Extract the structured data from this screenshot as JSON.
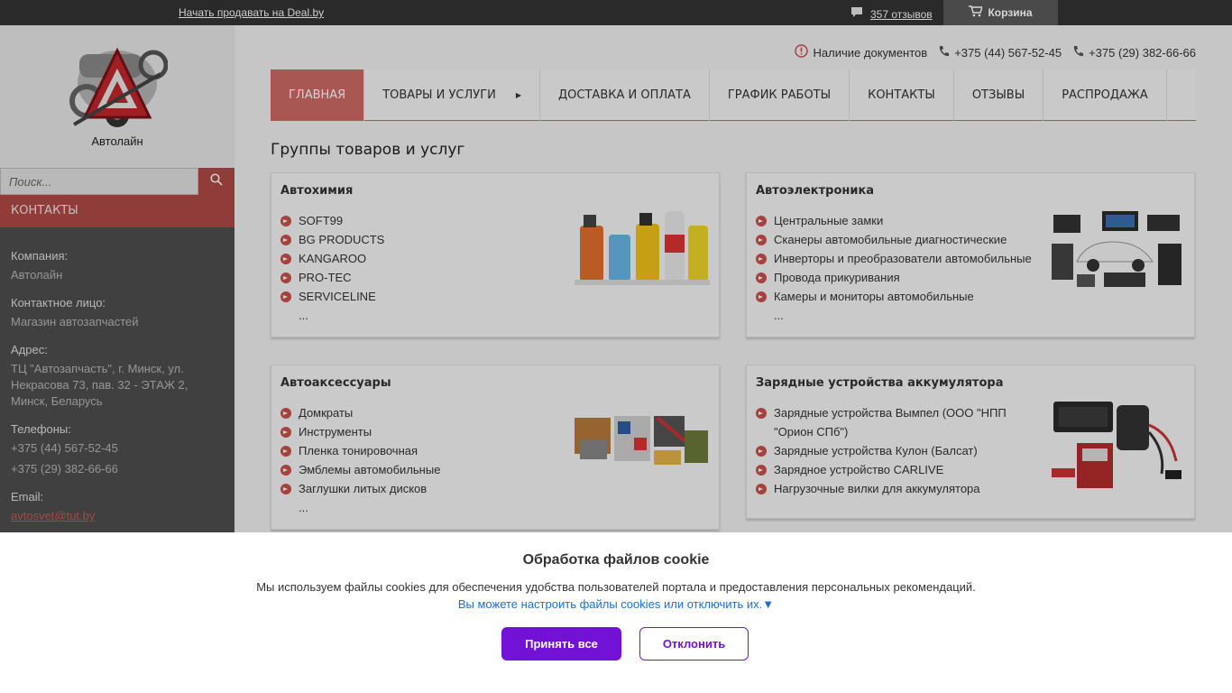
{
  "topbar": {
    "sell_link": "Начать продавать на Deal.by",
    "reviews": "357 отзывов",
    "cart": "Корзина"
  },
  "sidebar": {
    "company_name": "Автолайн",
    "search_placeholder": "Поиск...",
    "section_title": "КОНТАКТЫ",
    "contacts": {
      "company_label": "Компания:",
      "company_value": "Автолайн",
      "person_label": "Контактное лицо:",
      "person_value": "Магазин автозапчастей",
      "address_label": "Адрес:",
      "address_value": "ТЦ \"Автозапчасть\", г. Минск, ул. Некрасова 73, пав. 32 - ЭТАЖ 2, Минск, Беларусь",
      "phones_label": "Телефоны:",
      "phone1": "+375 (44) 567-52-45",
      "phone2": "+375 (29) 382-66-66",
      "email_label": "Email:",
      "email": "avtosvet@tut.by"
    }
  },
  "header": {
    "docs": "Наличие документов",
    "phone1": "+375 (44) 567-52-45",
    "phone2": "+375 (29) 382-66-66"
  },
  "nav": {
    "items": [
      "ГЛАВНАЯ",
      "ТОВАРЫ И УСЛУГИ",
      "ДОСТАВКА И ОПЛАТА",
      "ГРАФИК РАБОТЫ",
      "КОНТАКТЫ",
      "ОТЗЫВЫ",
      "РАСПРОДАЖА"
    ]
  },
  "main": {
    "title": "Группы товаров и услуг",
    "groups": [
      {
        "title": "Автохимия",
        "items": [
          "SOFT99",
          "BG PRODUCTS",
          "KANGAROO",
          "PRO-TEC",
          "SERVICELINE"
        ],
        "more": "..."
      },
      {
        "title": "Автоэлектроника",
        "items": [
          "Центральные замки",
          "Сканеры автомобильные диагностические",
          "Инверторы и преобразователи автомобильные",
          "Провода прикуривания",
          "Камеры и мониторы автомобильные"
        ],
        "more": "..."
      },
      {
        "title": "Автоаксессуары",
        "items": [
          "Домкраты",
          "Инструменты",
          "Пленка тонировочная",
          "Эмблемы автомобильные",
          "Заглушки литых дисков"
        ],
        "more": "..."
      },
      {
        "title": "Зарядные устройства аккумулятора",
        "items": [
          "Зарядные устройства Вымпел (ООО \"НПП \"Орион СПб\")",
          "Зарядные устройства Кулон (Балсат)",
          "Зарядное устройство CARLIVE",
          "Нагрузочные вилки для аккумулятора"
        ]
      }
    ]
  },
  "cookie": {
    "title": "Обработка файлов cookie",
    "text": "Мы используем файлы cookies для обеспечения удобства пользователей портала и предоставления персональных рекомендаций.",
    "link": "Вы можете настроить файлы cookies или отключить их.▼",
    "accept": "Принять все",
    "decline": "Отклонить"
  },
  "colors": {
    "accent": "#cf6b66",
    "cookie_button": "#7112d6",
    "link": "#1a6fd6"
  }
}
